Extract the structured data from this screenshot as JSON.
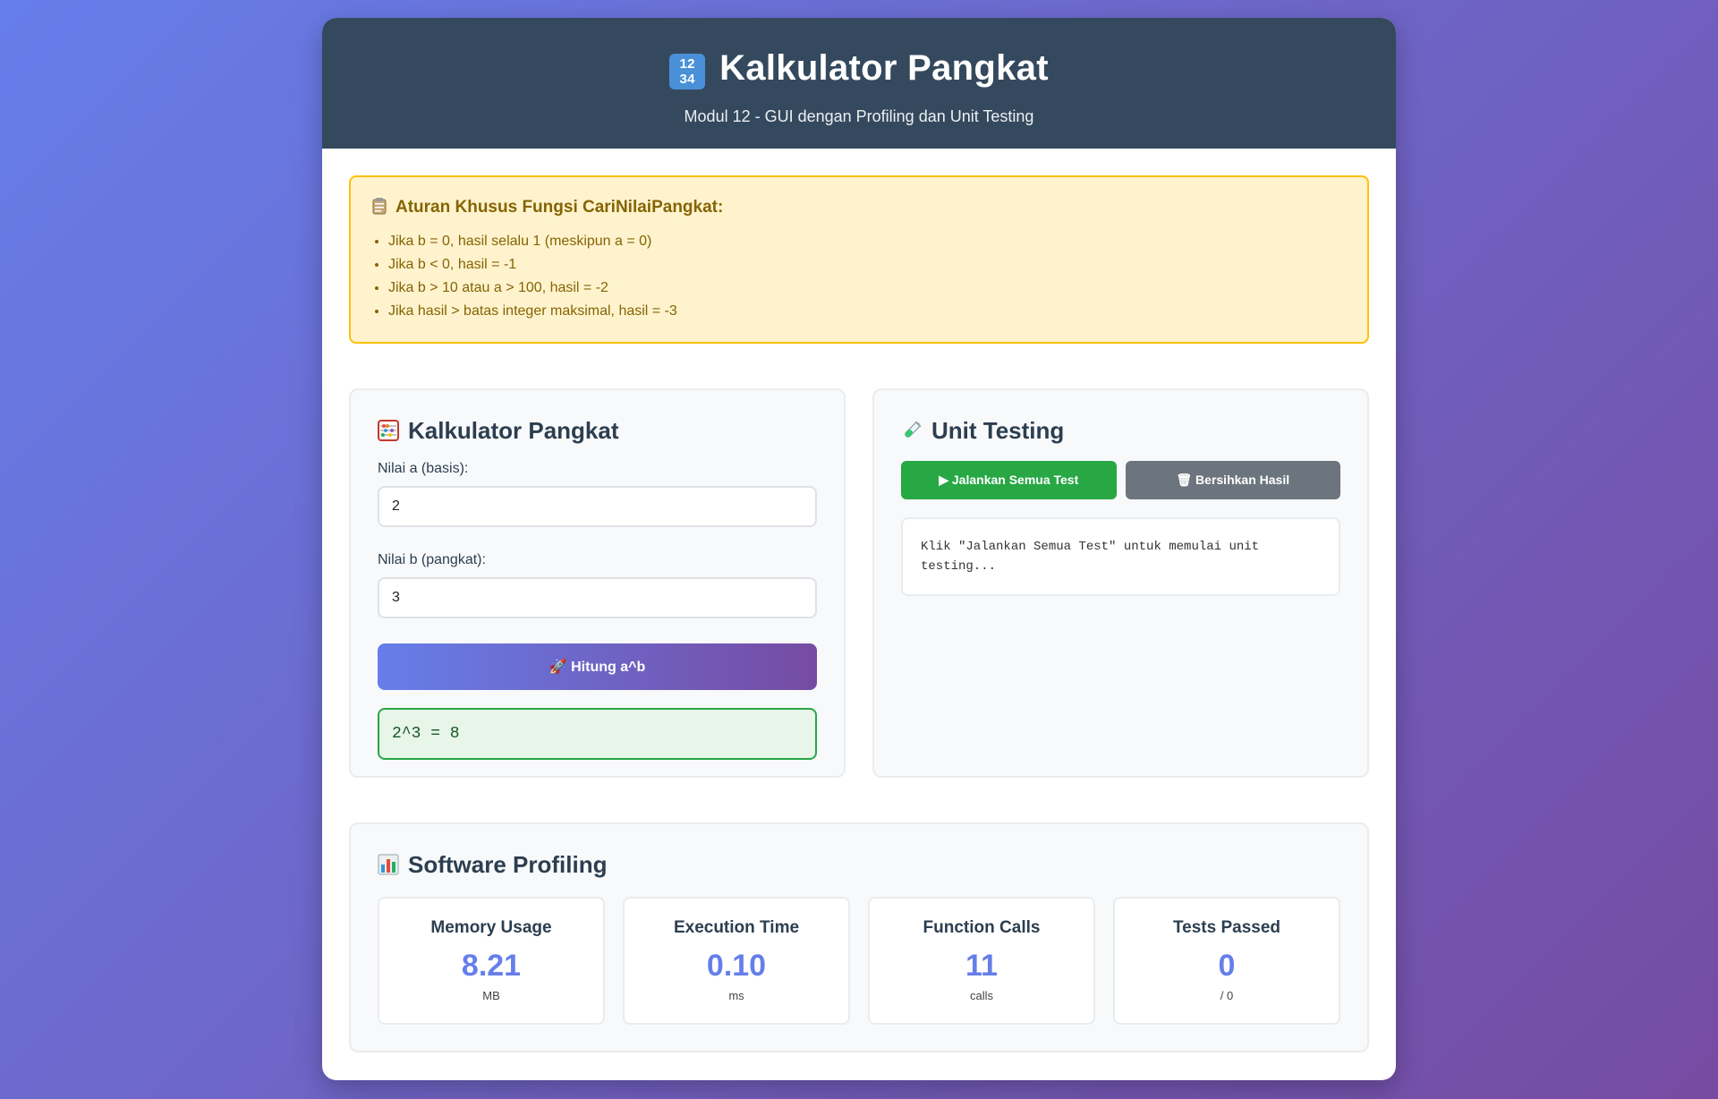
{
  "header": {
    "icon": "1234-keycap-icon",
    "title": "Kalkulator Pangkat",
    "subtitle": "Modul 12 - GUI dengan Profiling dan Unit Testing"
  },
  "rules": {
    "title": "Aturan Khusus Fungsi CariNilaiPangkat:",
    "items": [
      "Jika b = 0, hasil selalu 1 (meskipun a = 0)",
      "Jika b < 0, hasil = -1",
      "Jika b > 10 atau a > 100, hasil = -2",
      "Jika hasil > batas integer maksimal, hasil = -3"
    ]
  },
  "calculator": {
    "title": "Kalkulator Pangkat",
    "label_a": "Nilai a (basis):",
    "value_a": "2",
    "label_b": "Nilai b (pangkat):",
    "value_b": "3",
    "button": "🚀 Hitung a^b",
    "result": "2^3 = 8"
  },
  "testing": {
    "title": "Unit Testing",
    "run_button": "▶ Jalankan Semua Test",
    "clear_button": "🗑 Bersihkan Hasil",
    "output": "Klik \"Jalankan Semua Test\" untuk memulai unit testing..."
  },
  "profiling": {
    "title": "Software Profiling",
    "stats": [
      {
        "label": "Memory Usage",
        "value": "8.21",
        "unit": "MB"
      },
      {
        "label": "Execution Time",
        "value": "0.10",
        "unit": "ms"
      },
      {
        "label": "Function Calls",
        "value": "11",
        "unit": "calls"
      },
      {
        "label": "Tests Passed",
        "value": "0",
        "unit": "/ 0"
      }
    ]
  },
  "colors": {
    "header_bg": "#34495e",
    "accent": "#667eea",
    "success": "#28a745",
    "warning_bg": "#fff3cd"
  }
}
